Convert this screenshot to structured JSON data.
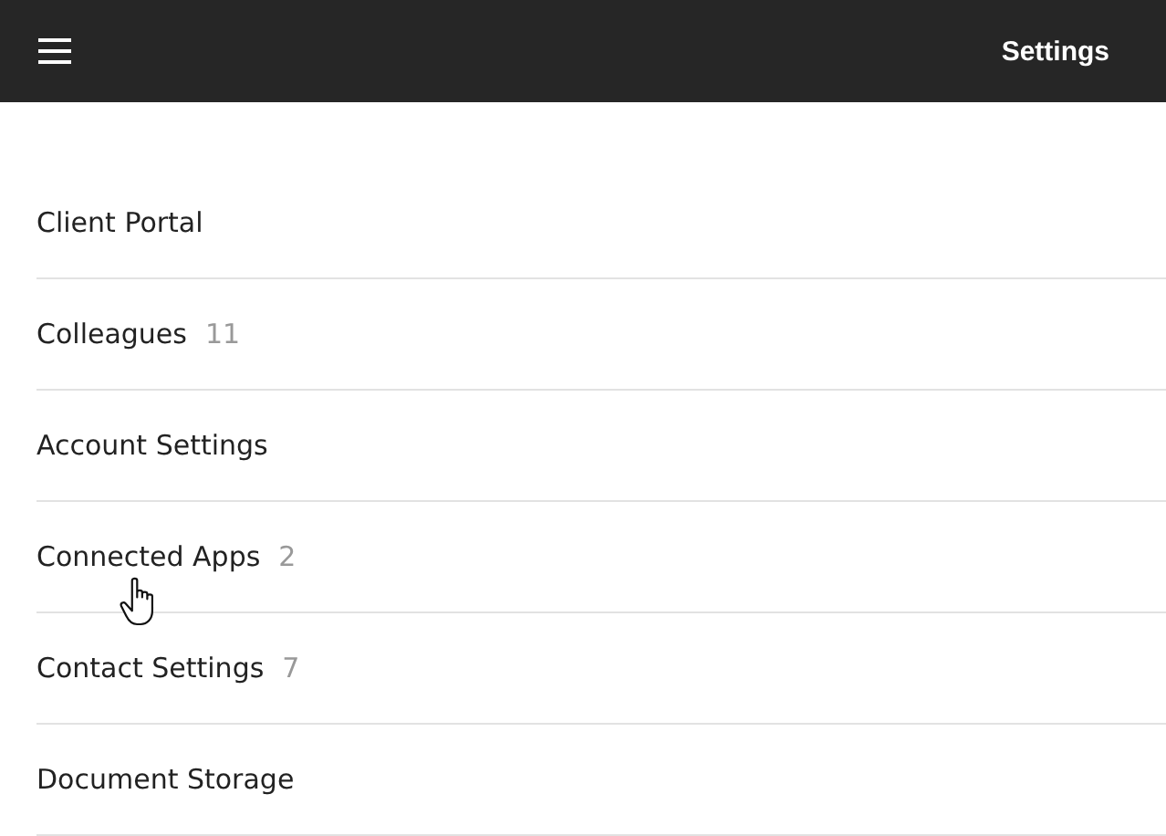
{
  "header": {
    "title": "Settings"
  },
  "items": [
    {
      "label": "Client Portal"
    },
    {
      "label": "Colleagues",
      "count": "11"
    },
    {
      "label": "Account Settings"
    },
    {
      "label": "Connected Apps",
      "count": "2",
      "hovered": true
    },
    {
      "label": "Contact Settings",
      "count": "7"
    },
    {
      "label": "Document Storage"
    }
  ]
}
